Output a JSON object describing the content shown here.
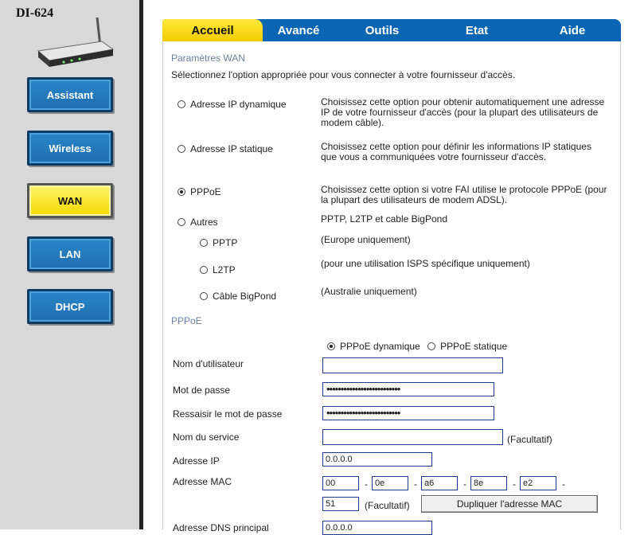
{
  "sidebar": {
    "model": "DI-624",
    "nav": [
      {
        "label": "Assistant",
        "active": false
      },
      {
        "label": "Wireless",
        "active": false
      },
      {
        "label": "WAN",
        "active": true
      },
      {
        "label": "LAN",
        "active": false
      },
      {
        "label": "DHCP",
        "active": false
      }
    ]
  },
  "tabs": [
    "Accueil",
    "Avancé",
    "Outils",
    "Etat",
    "Aide"
  ],
  "active_tab": "Accueil",
  "wan": {
    "title": "Paramètres WAN",
    "intro": "Sélectionnez l'option appropriée pour vous connecter à votre fournisseur d'accès.",
    "options": [
      {
        "label": "Adresse IP dynamique",
        "checked": false,
        "desc": "Choisissez cette option pour obtenir automatiquement une adresse IP de votre fournisseur d'accès (pour la plupart des utilisateurs de modem câble)."
      },
      {
        "label": "Adresse IP statique",
        "checked": false,
        "desc": "Choisissez cette option pour définir les informations IP statiques que vous a communiquées votre fournisseur d'accès."
      },
      {
        "label": "PPPoE",
        "checked": true,
        "desc": "Choisissez cette option si votre FAI utilise le protocole PPPoE (pour la plupart des utilisateurs de modem ADSL)."
      },
      {
        "label": "Autres",
        "checked": false,
        "desc": "PPTP, L2TP et cable BigPond"
      }
    ],
    "sub_options": [
      {
        "label": "PPTP",
        "desc": "(Europe uniquement)"
      },
      {
        "label": "L2TP",
        "desc": "(pour une utilisation ISPS spécifique uniquement)"
      },
      {
        "label": "Câble BigPond",
        "desc": "(Australie uniquement)"
      }
    ]
  },
  "pppoe": {
    "title": "PPPoE",
    "mode_dynamic": "PPPoE dynamique",
    "mode_static": "PPPoE statique",
    "username_label": "Nom d'utilisateur",
    "username_value": "",
    "password_label": "Mot de passe",
    "password_value": "••••••••••••••••••••••••••",
    "confirm_label": "Ressaisir le mot de passe",
    "confirm_value": "••••••••••••••••••••••••••",
    "service_label": "Nom du service",
    "service_value": "",
    "optional": "(Facultatif)",
    "ip_label": "Adresse IP",
    "ip_value": "0.0.0.0",
    "mac_label": "Adresse MAC",
    "mac": [
      "00",
      "0e",
      "a6",
      "8e",
      "e2",
      "51"
    ],
    "mac_sep": "-",
    "clone_button": "Dupliquer l'adresse MAC",
    "dns_label": "Adresse DNS principal",
    "dns_value": "0.0.0.0"
  },
  "colors": {
    "tab_blue": "#0a66b3",
    "tab_active": "#f3cb00",
    "nav_blue": "#1e6fb0",
    "nav_active": "#f4d900",
    "section_title": "#6c7f9a"
  }
}
